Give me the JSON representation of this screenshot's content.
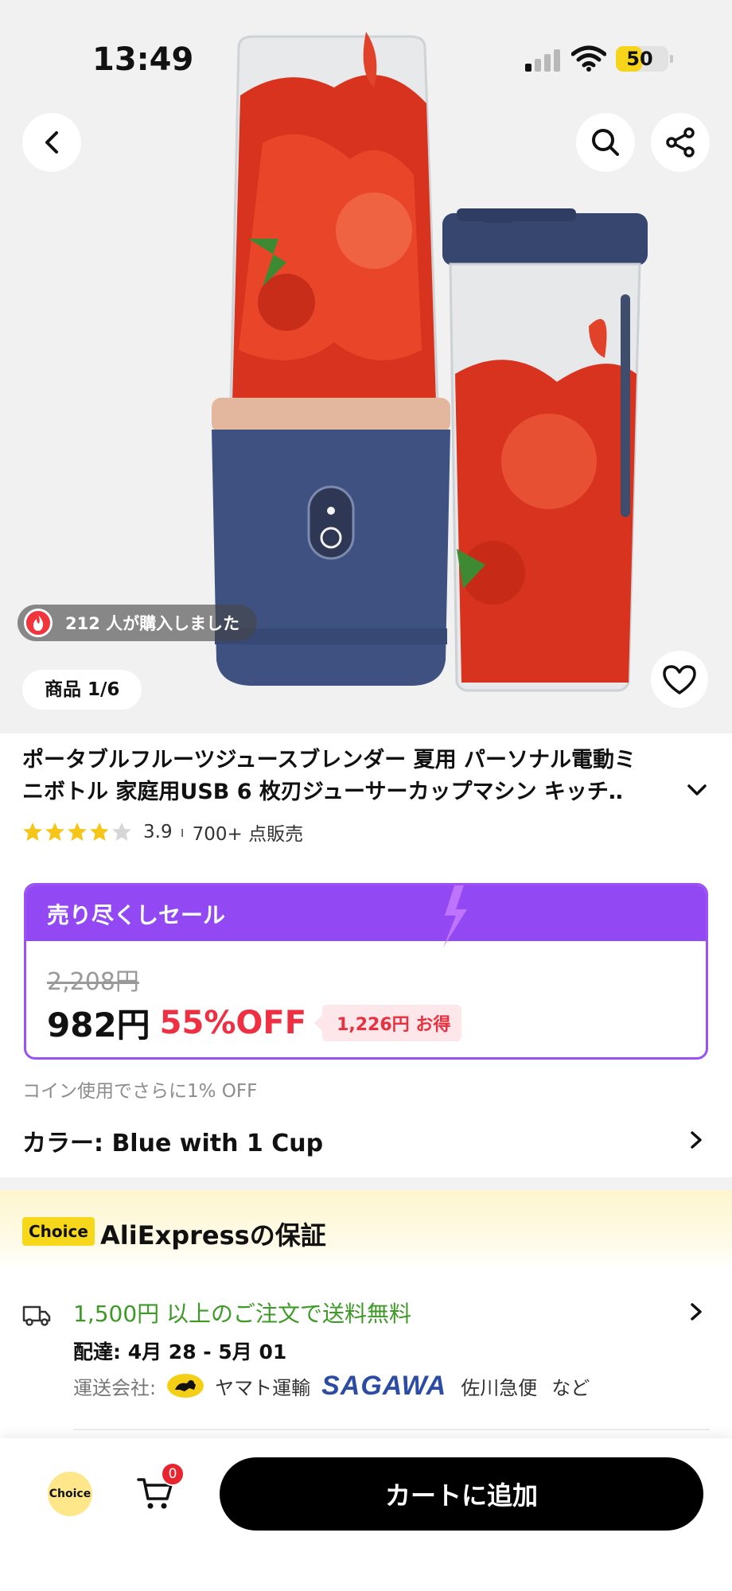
{
  "status_bar": {
    "time": "13:49",
    "battery_level": "50",
    "battery_fraction": 0.5,
    "icons": [
      "signal-icon",
      "wifi-icon",
      "battery-icon"
    ]
  },
  "hero": {
    "buyers_text": "212 人が購入しました",
    "image_counter": "商品 1/6",
    "icons": [
      "back-chevron-icon",
      "search-icon",
      "share-icon",
      "heart-icon",
      "flame-icon"
    ]
  },
  "product": {
    "title_line1": "ポータブルフルーツジュースブレンダー 夏用 パーソナル電動ミ",
    "title_line2": "ニボトル 家庭用USB 6 枚刃ジューサーカップマシン キッチ‥",
    "rating": "3.9",
    "rating_value": 3.9,
    "rating_max": 5,
    "sold": "700+ 点販売"
  },
  "sale": {
    "title": "売り尽くしセール",
    "original_price": "2,208円",
    "price": "982円",
    "discount": "55%OFF",
    "savings": "1,226円 お得",
    "accent_color": "#9249f4",
    "discount_color": "#ef2f42"
  },
  "coin_note": "コイン使用でさらに1% OFF",
  "color_option": "カラー: Blue with 1 Cup",
  "choice": {
    "tag": "Choice",
    "title": "AliExpressの保証"
  },
  "shipping": {
    "free_shipping": "1,500円 以上のご注文で送料無料",
    "delivery": "配達: 4月 28 - 5月 01",
    "carrier_label": "運送会社:",
    "carriers": [
      "ヤマト運輸",
      "佐川急便"
    ],
    "sagawa_logo": "SAGAWA",
    "etc": "など",
    "text_color": "#3e9a26"
  },
  "bottom_bar": {
    "choice_label": "Choice",
    "cart_count": "0",
    "add_to_cart": "カートに追加"
  }
}
